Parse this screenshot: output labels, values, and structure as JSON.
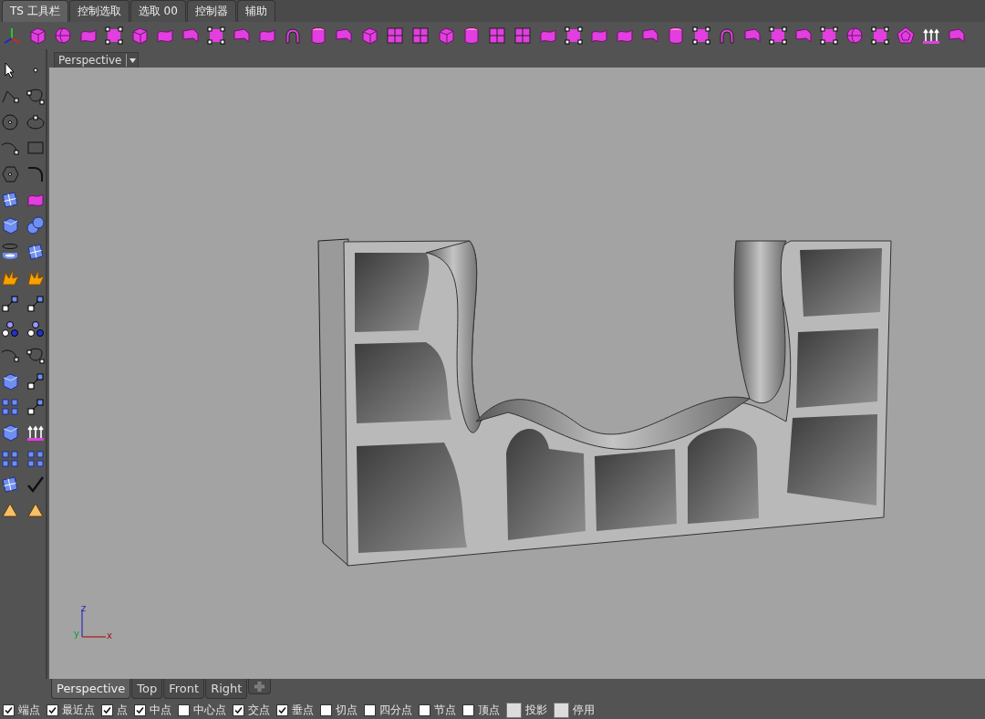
{
  "toolbar_tabs": [
    {
      "label": "TS 工具栏",
      "selected": true
    },
    {
      "label": "控制选取",
      "selected": false
    },
    {
      "label": "选取 00",
      "selected": false
    },
    {
      "label": "控制器",
      "selected": false
    },
    {
      "label": "辅助",
      "selected": false
    }
  ],
  "viewport": {
    "title": "Perspective",
    "axis_labels": {
      "z": "z",
      "y": "y",
      "x": "x"
    }
  },
  "viewport_tabs": [
    {
      "label": "Perspective",
      "selected": true
    },
    {
      "label": "Top",
      "selected": false
    },
    {
      "label": "Front",
      "selected": false
    },
    {
      "label": "Right",
      "selected": false
    }
  ],
  "osnaps": [
    {
      "kind": "checkbox",
      "label": "端点",
      "checked": true
    },
    {
      "kind": "checkbox",
      "label": "最近点",
      "checked": true
    },
    {
      "kind": "checkbox",
      "label": "点",
      "checked": true
    },
    {
      "kind": "checkbox",
      "label": "中点",
      "checked": true
    },
    {
      "kind": "checkbox",
      "label": "中心点",
      "checked": false
    },
    {
      "kind": "checkbox",
      "label": "交点",
      "checked": true
    },
    {
      "kind": "checkbox",
      "label": "垂点",
      "checked": true
    },
    {
      "kind": "checkbox",
      "label": "切点",
      "checked": false
    },
    {
      "kind": "checkbox",
      "label": "四分点",
      "checked": false
    },
    {
      "kind": "checkbox",
      "label": "节点",
      "checked": false
    },
    {
      "kind": "checkbox",
      "label": "顶点",
      "checked": false
    },
    {
      "kind": "toggle",
      "label": "投影",
      "checked": false
    },
    {
      "kind": "toggle",
      "label": "停用",
      "checked": false
    }
  ]
}
